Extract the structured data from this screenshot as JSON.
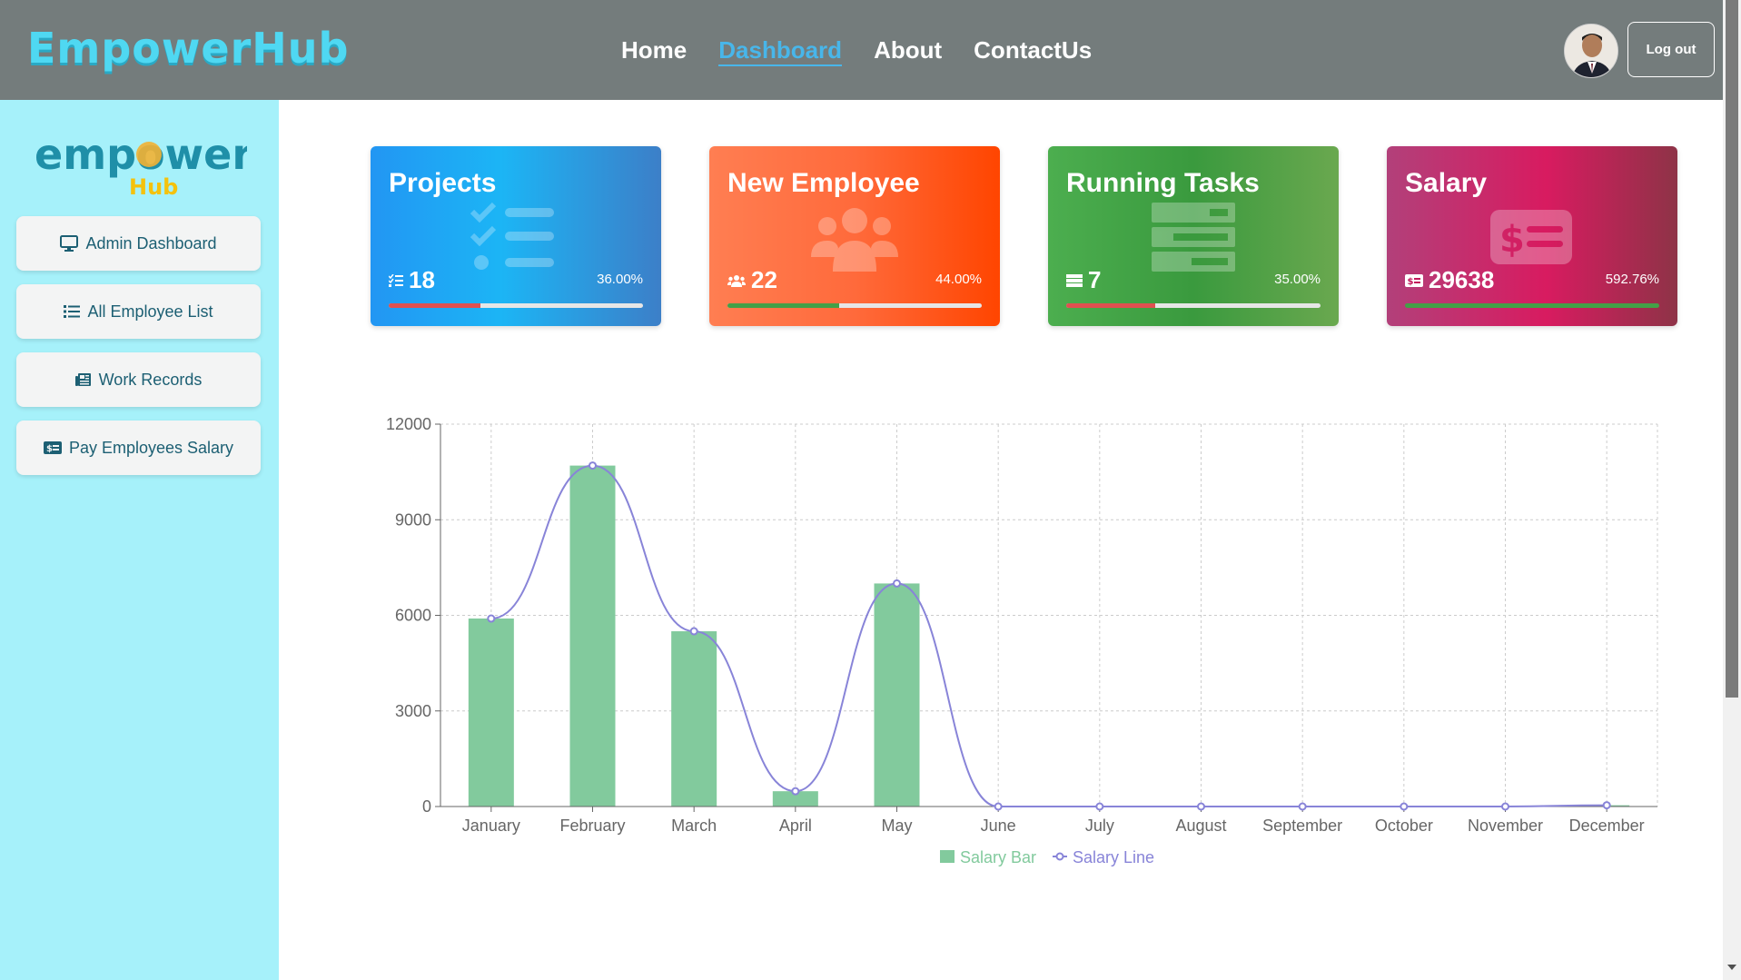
{
  "app": {
    "brand": "EmpowerHub"
  },
  "nav": {
    "links": [
      {
        "label": "Home",
        "active": false
      },
      {
        "label": "Dashboard",
        "active": true
      },
      {
        "label": "About",
        "active": false
      },
      {
        "label": "ContactUs",
        "active": false
      }
    ],
    "logout_label": "Log out"
  },
  "sidebar": {
    "logo_main": "empower",
    "logo_sub": "Hub",
    "items": [
      {
        "label": "Admin Dashboard",
        "icon": "desktop-icon"
      },
      {
        "label": "All Employee List",
        "icon": "list-icon"
      },
      {
        "label": "Work Records",
        "icon": "newspaper-icon"
      },
      {
        "label": "Pay Employees Salary",
        "icon": "money-check-icon"
      }
    ]
  },
  "cards": [
    {
      "title": "Projects",
      "value": "18",
      "percent": "36.00%",
      "progress": 0.36,
      "bar_color": "#e05050",
      "icon": "list-check-icon"
    },
    {
      "title": "New Employee",
      "value": "22",
      "percent": "44.00%",
      "progress": 0.44,
      "bar_color": "#43a047",
      "icon": "users-icon"
    },
    {
      "title": "Running Tasks",
      "value": "7",
      "percent": "35.00%",
      "progress": 0.35,
      "bar_color": "#e05050",
      "icon": "tasks-icon"
    },
    {
      "title": "Salary",
      "value": "29638",
      "percent": "592.76%",
      "progress": 1.0,
      "bar_color": "#43a047",
      "icon": "money-bill-icon"
    }
  ],
  "chart_data": {
    "type": "bar",
    "categories": [
      "January",
      "February",
      "March",
      "April",
      "May",
      "June",
      "July",
      "August",
      "September",
      "October",
      "November",
      "December"
    ],
    "series": [
      {
        "name": "Salary Bar",
        "type": "bar",
        "color": "#82ca9d",
        "values": [
          5900,
          10700,
          5500,
          480,
          7000,
          0,
          0,
          0,
          0,
          0,
          0,
          40
        ]
      },
      {
        "name": "Salary Line",
        "type": "line",
        "color": "#8884d8",
        "values": [
          5900,
          10700,
          5500,
          480,
          7000,
          0,
          0,
          0,
          0,
          0,
          0,
          40
        ]
      }
    ],
    "ylim": [
      0,
      12000
    ],
    "yticks": [
      0,
      3000,
      6000,
      9000,
      12000
    ],
    "grid": true,
    "legend": "bottom-center"
  }
}
